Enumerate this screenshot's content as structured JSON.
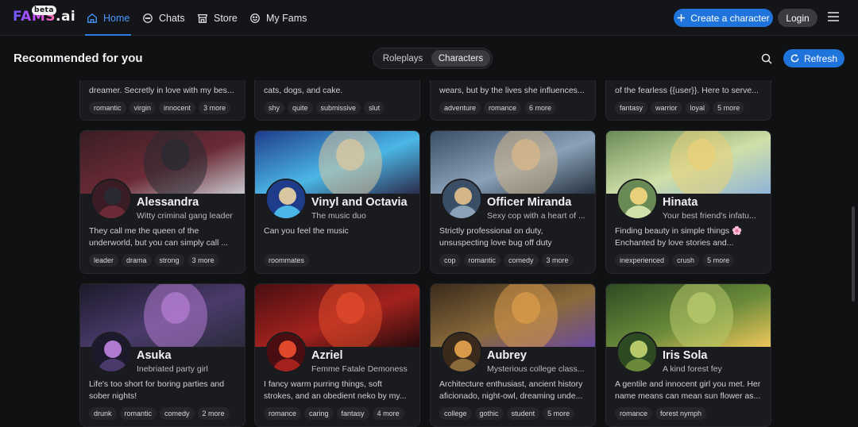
{
  "app": {
    "logo_main": "FAMS",
    "logo_suffix": ".ai",
    "logo_badge": "beta"
  },
  "nav": {
    "items": [
      {
        "label": "Home",
        "icon": "home-icon",
        "active": true
      },
      {
        "label": "Chats",
        "icon": "chat-bubble-icon",
        "active": false
      },
      {
        "label": "Store",
        "icon": "store-icon",
        "active": false
      },
      {
        "label": "My Fams",
        "icon": "smiley-icon",
        "active": false
      }
    ],
    "create_label": "Create a character",
    "login_label": "Login"
  },
  "subheader": {
    "title": "Recommended for you",
    "toggle": [
      "Roleplays",
      "Characters"
    ],
    "selected_toggle": "Characters",
    "refresh_label": "Refresh"
  },
  "colors": {
    "accent": "#1f74dc",
    "active_nav": "#4a98ff",
    "bg": "#101113",
    "card": "#1a1b1e"
  },
  "top_row": [
    {
      "desc": "dreamer. Secretly in love with my bes...",
      "tags": [
        "romantic",
        "virgin",
        "innocent",
        "3 more"
      ]
    },
    {
      "desc": "cats, dogs, and cake.",
      "tags": [
        "shy",
        "quite",
        "submissive",
        "slut"
      ]
    },
    {
      "desc": "wears, but by the lives she influences...",
      "tags": [
        "adventure",
        "romance",
        "6 more"
      ]
    },
    {
      "desc": "of the fearless {{user}}. Here to serve...",
      "tags": [
        "fantasy",
        "warrior",
        "loyal",
        "5 more"
      ]
    }
  ],
  "cards": [
    {
      "name": "Alessandra",
      "tagline": "Witty criminal gang leader",
      "desc": [
        "They call me the queen of the",
        "underworld, but you can simply call ..."
      ],
      "tags": [
        "leader",
        "drama",
        "strong",
        "3 more"
      ]
    },
    {
      "name": "Vinyl and Octavia",
      "tagline": "The music duo",
      "desc": [
        "Can you feel the music",
        ""
      ],
      "tags": [
        "roommates"
      ]
    },
    {
      "name": "Officer Miranda",
      "tagline": "Sexy cop with a heart of ...",
      "desc": [
        "Strictly professional on duty,",
        "unsuspecting love bug off duty"
      ],
      "tags": [
        "cop",
        "romantic",
        "comedy",
        "3 more"
      ]
    },
    {
      "name": "Hinata",
      "tagline": "Your best friend's infatu...",
      "desc": [
        "Finding beauty in simple things 🌸",
        "Enchanted by love stories and..."
      ],
      "tags": [
        "inexperienced",
        "crush",
        "5 more"
      ]
    },
    {
      "name": "Asuka",
      "tagline": "Inebriated party girl",
      "desc": [
        "Life's too short for boring parties and",
        "sober nights!"
      ],
      "tags": [
        "drunk",
        "romantic",
        "comedy",
        "2 more"
      ]
    },
    {
      "name": "Azriel",
      "tagline": "Femme Fatale Demoness",
      "desc": [
        "I fancy warm purring things, soft",
        "strokes, and an obedient neko by my..."
      ],
      "tags": [
        "romance",
        "caring",
        "fantasy",
        "4 more"
      ]
    },
    {
      "name": "Aubrey",
      "tagline": "Mysterious college class...",
      "desc": [
        "Architecture enthusiast, ancient history",
        "aficionado, night-owl, dreaming unde..."
      ],
      "tags": [
        "college",
        "gothic",
        "student",
        "5 more"
      ]
    },
    {
      "name": "Iris Sola",
      "tagline": "A kind forest fey",
      "desc": [
        "A gentile and innocent girl you met. Her",
        "name means can mean sun flower as..."
      ],
      "tags": [
        "romance",
        "forest nymph"
      ]
    }
  ]
}
